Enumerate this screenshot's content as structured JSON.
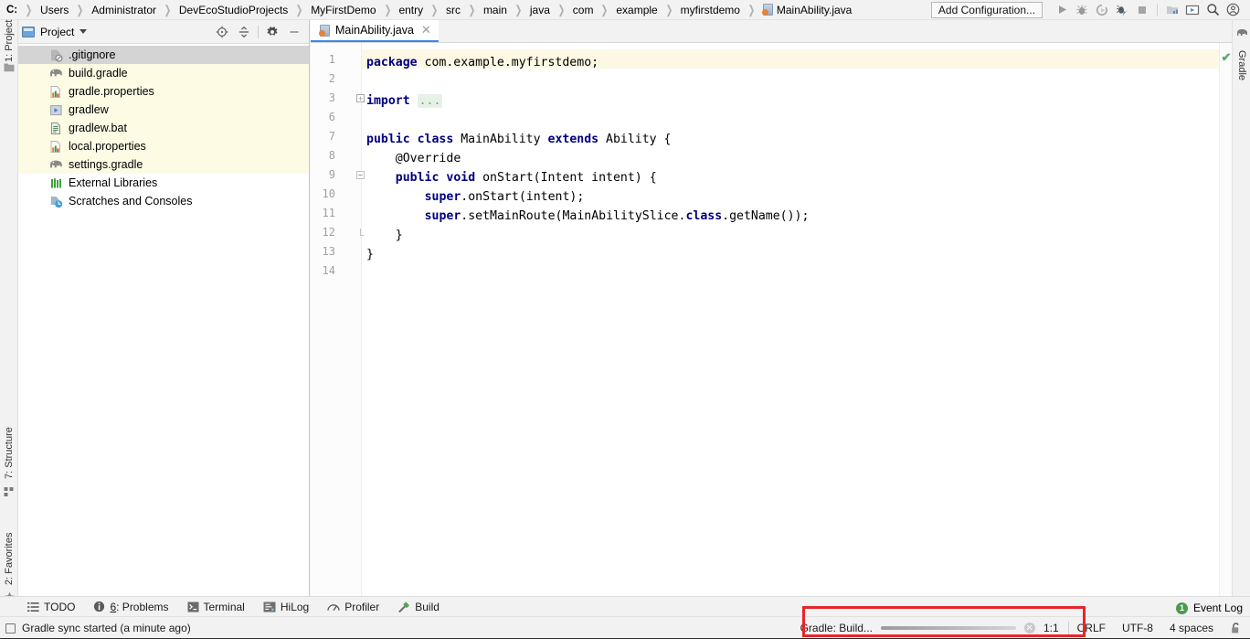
{
  "breadcrumb": {
    "name": "path-breadcrumb",
    "items": [
      {
        "label": "C:",
        "icon": "drive"
      },
      {
        "label": "Users",
        "icon": ""
      },
      {
        "label": "Administrator",
        "icon": ""
      },
      {
        "label": "DevEcoStudioProjects",
        "icon": ""
      },
      {
        "label": "MyFirstDemo",
        "icon": ""
      },
      {
        "label": "entry",
        "icon": ""
      },
      {
        "label": "src",
        "icon": ""
      },
      {
        "label": "main",
        "icon": ""
      },
      {
        "label": "java",
        "icon": ""
      },
      {
        "label": "com",
        "icon": ""
      },
      {
        "label": "example",
        "icon": ""
      },
      {
        "label": "myfirstdemo",
        "icon": ""
      },
      {
        "label": "MainAbility.java",
        "icon": "java-class-icon"
      }
    ]
  },
  "toolbar": {
    "add_configuration_label": "Add Configuration...",
    "icons": [
      {
        "name": "run-icon",
        "glyph": "▶"
      },
      {
        "name": "debug-icon",
        "glyph": "bug"
      },
      {
        "name": "run-coverage-icon",
        "glyph": "coverage"
      },
      {
        "name": "profile-icon",
        "glyph": "profile"
      },
      {
        "name": "stop-icon",
        "glyph": "■"
      },
      {
        "name": "sdk-manager-icon",
        "glyph": "sdk"
      },
      {
        "name": "device-manager-icon",
        "glyph": "device"
      },
      {
        "name": "search-everywhere-icon",
        "glyph": "⚲"
      },
      {
        "name": "account-icon",
        "glyph": "account"
      }
    ]
  },
  "left_strip": {
    "tabs": [
      {
        "name": "sidebar-tab-project",
        "label": "1: Project",
        "icon": "project-icon"
      },
      {
        "name": "sidebar-tab-structure",
        "label": "7: Structure",
        "icon": "structure-icon"
      },
      {
        "name": "sidebar-tab-favorites",
        "label": "2: Favorites",
        "icon": "star-icon"
      }
    ]
  },
  "right_strip": {
    "tabs": [
      {
        "name": "sidebar-tab-gradle",
        "label": "Gradle",
        "icon": "gradle-elephant-icon"
      }
    ]
  },
  "project_panel": {
    "title": "Project",
    "actions": [
      {
        "name": "select-opened-file-icon",
        "tooltip": "Select Opened File"
      },
      {
        "name": "collapse-all-icon",
        "tooltip": "Collapse All"
      },
      {
        "name": "settings-gear-icon",
        "tooltip": "Settings"
      },
      {
        "name": "hide-panel-icon",
        "tooltip": "Hide"
      }
    ],
    "tree": [
      {
        "label": ".gitignore",
        "icon": "gitignore-icon",
        "selected": true,
        "highlight": false
      },
      {
        "label": "build.gradle",
        "icon": "gradle-elephant-icon",
        "selected": false,
        "highlight": true
      },
      {
        "label": "gradle.properties",
        "icon": "properties-icon",
        "selected": false,
        "highlight": true
      },
      {
        "label": "gradlew",
        "icon": "script-icon",
        "selected": false,
        "highlight": true
      },
      {
        "label": "gradlew.bat",
        "icon": "bat-file-icon",
        "selected": false,
        "highlight": true
      },
      {
        "label": "local.properties",
        "icon": "properties-icon",
        "selected": false,
        "highlight": true
      },
      {
        "label": "settings.gradle",
        "icon": "gradle-elephant-icon",
        "selected": false,
        "highlight": true
      },
      {
        "label": "External Libraries",
        "icon": "libraries-icon",
        "selected": false,
        "highlight": false
      },
      {
        "label": "Scratches and Consoles",
        "icon": "scratches-icon",
        "selected": false,
        "highlight": false
      }
    ]
  },
  "editor": {
    "tab": {
      "label": "MainAbility.java",
      "icon": "java-class-icon",
      "close": "✕"
    },
    "inspection_status": "✔",
    "line_numbers": [
      "1",
      "2",
      "3",
      "6",
      "7",
      "8",
      "9",
      "10",
      "11",
      "12",
      "13",
      "14"
    ],
    "lines": [
      {
        "num": "1",
        "indent": 0,
        "tokens": [
          {
            "t": "package",
            "c": "kw"
          },
          {
            "t": " com.example.myfirstdemo;",
            "c": "plain"
          }
        ],
        "highlighted": true,
        "fold": ""
      },
      {
        "num": "2",
        "indent": 0,
        "tokens": [],
        "highlighted": false,
        "fold": ""
      },
      {
        "num": "3",
        "indent": 0,
        "tokens": [
          {
            "t": "import",
            "c": "kw"
          },
          {
            "t": " ",
            "c": "plain"
          },
          {
            "t": "...",
            "c": "fold-dots"
          }
        ],
        "highlighted": false,
        "fold": "plus"
      },
      {
        "num": "6",
        "indent": 0,
        "tokens": [],
        "highlighted": false,
        "fold": ""
      },
      {
        "num": "7",
        "indent": 0,
        "tokens": [
          {
            "t": "public class",
            "c": "kw"
          },
          {
            "t": " MainAbility ",
            "c": "plain"
          },
          {
            "t": "extends",
            "c": "kw"
          },
          {
            "t": " Ability {",
            "c": "plain"
          }
        ],
        "highlighted": false,
        "fold": ""
      },
      {
        "num": "8",
        "indent": 4,
        "tokens": [
          {
            "t": "@Override",
            "c": "plain"
          }
        ],
        "highlighted": false,
        "fold": ""
      },
      {
        "num": "9",
        "indent": 4,
        "tokens": [
          {
            "t": "public void",
            "c": "kw"
          },
          {
            "t": " onStart(Intent intent) {",
            "c": "plain"
          }
        ],
        "highlighted": false,
        "fold": "minus"
      },
      {
        "num": "10",
        "indent": 8,
        "tokens": [
          {
            "t": "super",
            "c": "kw"
          },
          {
            "t": ".onStart(intent);",
            "c": "plain"
          }
        ],
        "highlighted": false,
        "fold": ""
      },
      {
        "num": "11",
        "indent": 8,
        "tokens": [
          {
            "t": "super",
            "c": "kw"
          },
          {
            "t": ".setMainRoute(MainAbilitySlice.",
            "c": "plain"
          },
          {
            "t": "class",
            "c": "kw"
          },
          {
            "t": ".getName());",
            "c": "plain"
          }
        ],
        "highlighted": false,
        "fold": ""
      },
      {
        "num": "12",
        "indent": 4,
        "tokens": [
          {
            "t": "}",
            "c": "plain"
          }
        ],
        "highlighted": false,
        "fold": "minus-end"
      },
      {
        "num": "13",
        "indent": 0,
        "tokens": [
          {
            "t": "}",
            "c": "plain"
          }
        ],
        "highlighted": false,
        "fold": ""
      },
      {
        "num": "14",
        "indent": 0,
        "tokens": [],
        "highlighted": false,
        "fold": ""
      }
    ]
  },
  "bottom_bar": {
    "buttons": [
      {
        "name": "tool-todo",
        "label": "TODO",
        "icon": "todo-icon",
        "prefix": ""
      },
      {
        "name": "tool-problems",
        "label": ": Problems",
        "icon": "problems-icon",
        "prefix": "6"
      },
      {
        "name": "tool-terminal",
        "label": "Terminal",
        "icon": "terminal-icon",
        "prefix": ""
      },
      {
        "name": "tool-hilog",
        "label": "HiLog",
        "icon": "hilog-icon",
        "prefix": ""
      },
      {
        "name": "tool-profiler",
        "label": "Profiler",
        "icon": "profiler-icon",
        "prefix": ""
      },
      {
        "name": "tool-build",
        "label": "Build",
        "icon": "build-hammer-icon",
        "prefix": ""
      }
    ]
  },
  "status_bar": {
    "message": "Gradle sync started (a minute ago)",
    "progress_label": "Gradle: Build...",
    "caret_position": "1:1",
    "line_separator": "CRLF",
    "encoding": "UTF-8",
    "indent": "4 spaces",
    "lock_icon": "read-write-lock-icon",
    "event_log_label": "Event Log",
    "event_log_count": "1"
  },
  "annotation": {
    "color": "#e8252a",
    "label": "gradle-build-progress-highlight"
  }
}
